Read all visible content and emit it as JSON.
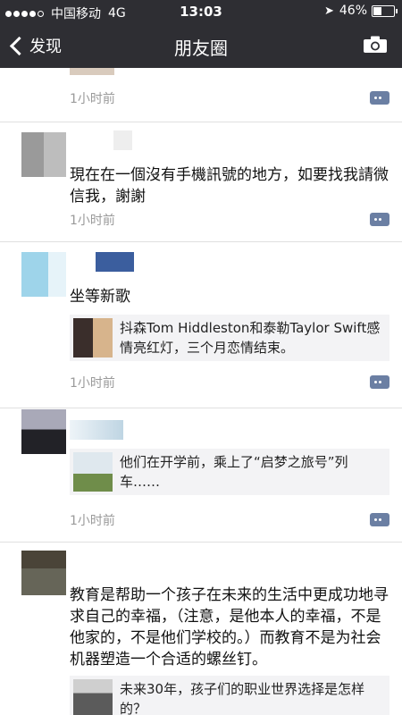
{
  "status_bar": {
    "carrier": "中国移动",
    "network": "4G",
    "time": "13:03",
    "battery": "46%",
    "battery_level": 0.46
  },
  "nav": {
    "back_label": "发现",
    "title": "朋友圈"
  },
  "posts": [
    {
      "time": "1小时前"
    },
    {
      "text": "現在在一個沒有手機訊號的地方，如要找我請微信我，謝謝",
      "time": "1小时前"
    },
    {
      "text": "坐等新歌",
      "share_title": "抖森Tom Hiddleston和泰勒Taylor Swift感情亮红灯，三个月恋情结束。",
      "time": "1小时前"
    },
    {
      "share_title": "他们在开学前，乘上了“启梦之旅号”列车……",
      "time": "1小时前"
    },
    {
      "text": "教育是帮助一个孩子在未来的生活中更成功地寻求自己的幸福，（注意，是他本人的幸福，不是他家的，不是他们学校的。）而教育不是为社会机器塑造一个合适的螺丝钉。",
      "share_title": "未来30年，孩子们的职业世界选择是怎样的？"
    }
  ],
  "colors": {
    "bar": "#2e2e33",
    "comment_icon": "#6b7fa3",
    "share_bg": "#f3f3f5",
    "time_text": "#9a9a9a"
  }
}
